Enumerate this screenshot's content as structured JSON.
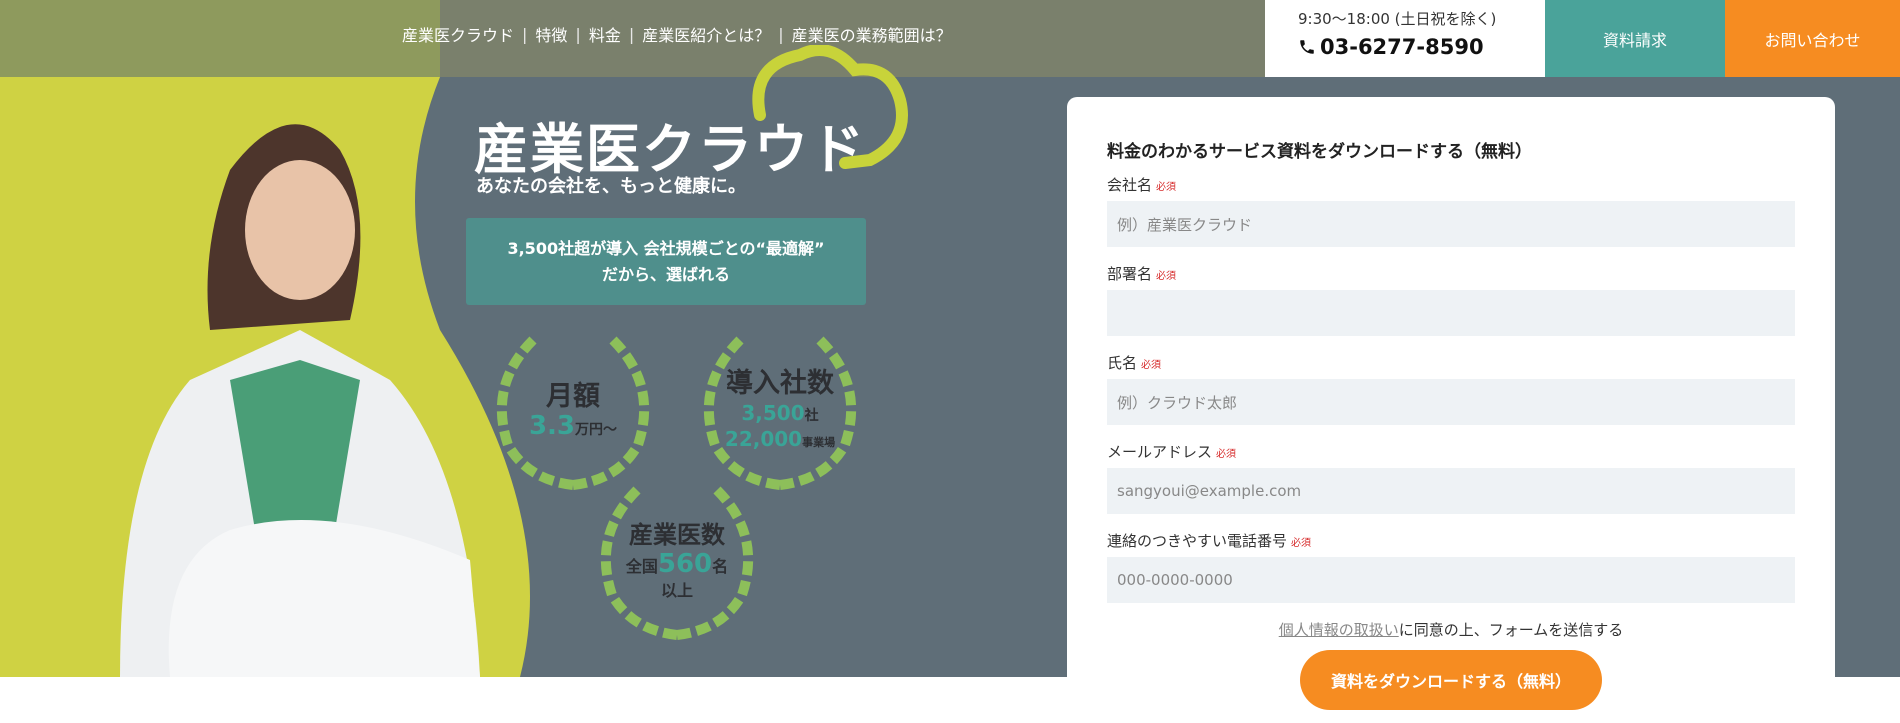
{
  "nav": {
    "items": [
      "産業医クラウド",
      "特徴",
      "料金",
      "産業医紹介とは？",
      "産業医の業務範囲は？"
    ],
    "separator": "|"
  },
  "contact": {
    "hours": "9:30〜18:00 (土日祝を除く)",
    "phone": "03-6277-8590"
  },
  "buttons": {
    "request": "資料請求",
    "contact": "お問い合わせ"
  },
  "brand": {
    "logo": "産業医クラウド",
    "tagline": "あなたの会社を、もっと健康に。"
  },
  "highlight": {
    "line1": "3,500社超が導入 会社規模ごとの“最適解”",
    "line2": "だから、選ばれる"
  },
  "badges": {
    "monthly": {
      "title": "月額",
      "value": "3.3",
      "unit": "万円〜"
    },
    "companies": {
      "title": "導入社数",
      "value1": "3,500",
      "unit1": "社",
      "value2": "22,000",
      "unit2": "事業場"
    },
    "doctors": {
      "title": "産業医数",
      "prefix": "全国",
      "value": "560",
      "unit": "名",
      "suffix": "以上"
    }
  },
  "form": {
    "title": "料金のわかるサービス資料をダウンロードする（無料）",
    "required": "必須",
    "fields": [
      {
        "label": "会社名",
        "placeholder": "例）産業医クラウド"
      },
      {
        "label": "部署名",
        "placeholder": ""
      },
      {
        "label": "氏名",
        "placeholder": "例）クラウド太郎"
      },
      {
        "label": "メールアドレス",
        "placeholder": "sangyoui@example.com"
      },
      {
        "label": "連絡のつきやすい電話番号",
        "placeholder": "000-0000-0000"
      }
    ],
    "consent_link": "個人情報の取扱い",
    "consent_text": "に同意の上、フォームを送信する",
    "submit": "資料をダウンロードする（無料）"
  },
  "colors": {
    "hero_bg": "#5f6e78",
    "accent_green": "#c8d33a",
    "teal": "#4aa39a",
    "orange": "#f68c21"
  }
}
